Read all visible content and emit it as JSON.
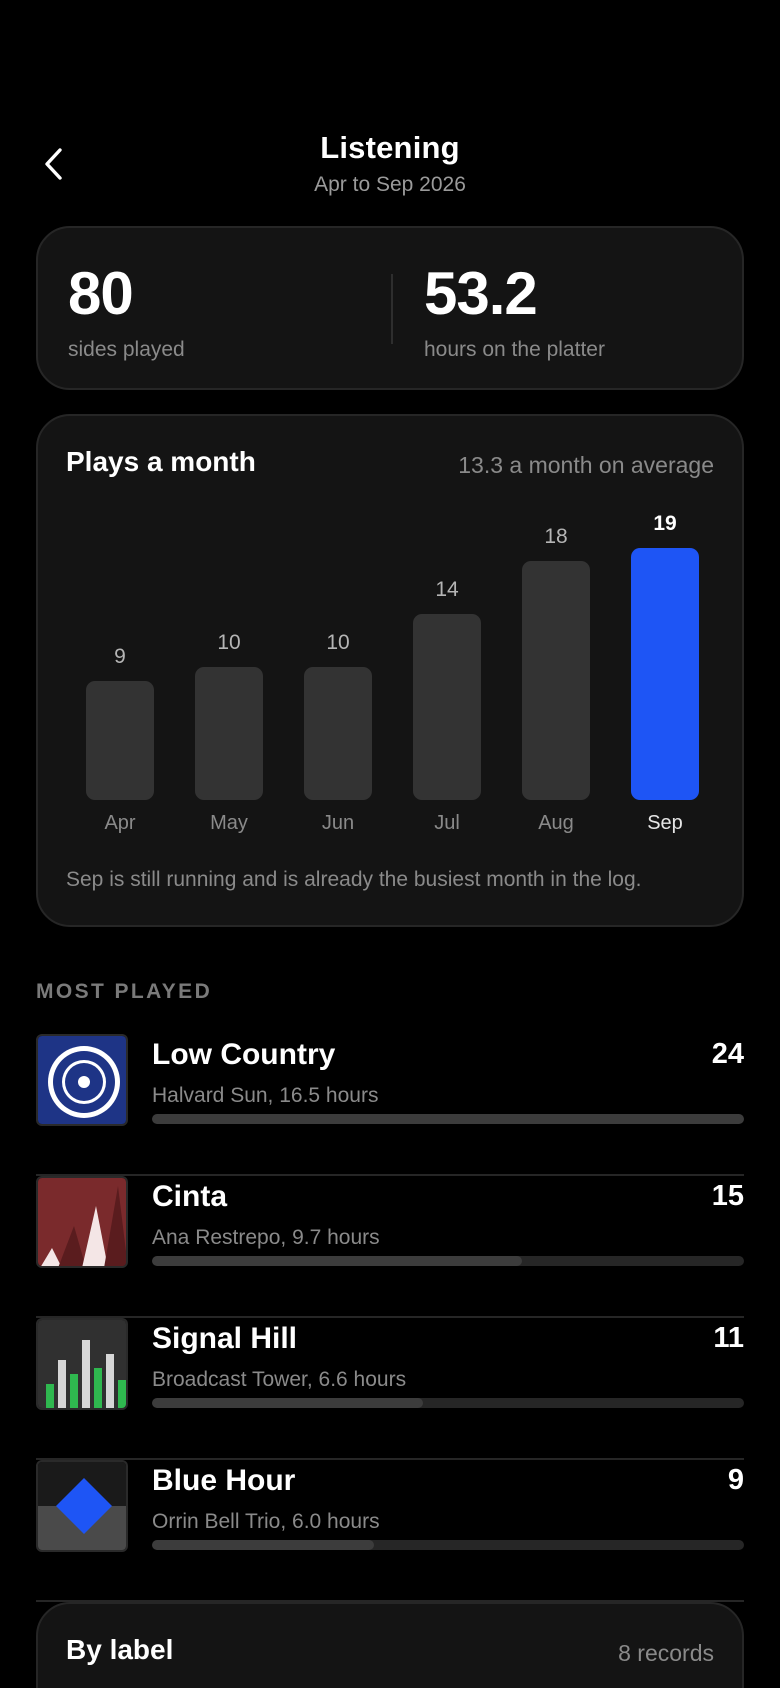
{
  "header": {
    "title": "Listening",
    "subtitle": "Apr to Sep 2026"
  },
  "stats": {
    "sides_played": "80",
    "sides_played_label": "sides played",
    "hours": "53.2",
    "hours_label": "hours on the platter"
  },
  "chart": {
    "title": "Plays a month",
    "average": "13.3 a month on average",
    "note": "Sep is still running and is already the busiest month in the log."
  },
  "chart_data": {
    "type": "bar",
    "categories": [
      "Apr",
      "May",
      "Jun",
      "Jul",
      "Aug",
      "Sep"
    ],
    "values": [
      9,
      10,
      10,
      14,
      18,
      19
    ],
    "highlight_index": 5,
    "colors": {
      "bar": "#333333",
      "highlight": "#1e55f5"
    }
  },
  "most_played": {
    "section_title": "MOST PLAYED",
    "items": [
      {
        "title": "Low Country",
        "subtitle": "Halvard Sun, 16.5 hours",
        "count": "24",
        "progress": 1.0
      },
      {
        "title": "Cinta",
        "subtitle": "Ana Restrepo, 9.7 hours",
        "count": "15",
        "progress": 0.625
      },
      {
        "title": "Signal Hill",
        "subtitle": "Broadcast Tower, 6.6 hours",
        "count": "11",
        "progress": 0.458
      },
      {
        "title": "Blue Hour",
        "subtitle": "Orrin Bell Trio, 6.0 hours",
        "count": "9",
        "progress": 0.375
      }
    ]
  },
  "by_label": {
    "title": "By label",
    "count": "8 records"
  }
}
